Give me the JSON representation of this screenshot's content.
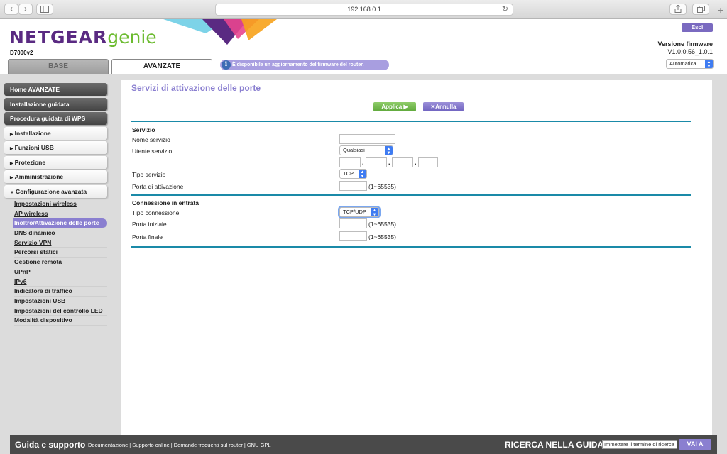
{
  "browser": {
    "url": "192.168.0.1"
  },
  "header": {
    "brand": "NETGEAR",
    "brand_suffix": "genie",
    "model": "D7000v2",
    "exit_label": "Esci",
    "firmware_title": "Versione firmware",
    "firmware_value": "V1.0.0.56_1.0.1",
    "tabs": [
      {
        "label": "BASE"
      },
      {
        "label": "AVANZATE"
      }
    ],
    "update_notice": "È disponibile un aggiornamento del firmware del router.",
    "language_selected": "Automatica",
    "banner_colors": [
      "#7dd3e8",
      "#5a2a82",
      "#e8458f",
      "#f7a21b"
    ]
  },
  "sidebar": {
    "main_items": [
      {
        "label": "Home AVANZATE"
      },
      {
        "label": "Installazione guidata"
      },
      {
        "label": "Procedura guidata di WPS"
      }
    ],
    "collapsible": [
      {
        "label": "Installazione"
      },
      {
        "label": "Funzioni USB"
      },
      {
        "label": "Protezione"
      },
      {
        "label": "Amministrazione"
      },
      {
        "label": "Configurazione avanzata"
      }
    ],
    "sub_items": [
      {
        "label": "Impostazioni wireless"
      },
      {
        "label": "AP wireless"
      },
      {
        "label": "Inoltro/Attivazione delle porte"
      },
      {
        "label": "DNS dinamico"
      },
      {
        "label": "Servizio VPN"
      },
      {
        "label": "Percorsi statici"
      },
      {
        "label": "Gestione remota"
      },
      {
        "label": "UPnP"
      },
      {
        "label": "IPv6"
      },
      {
        "label": "Indicatore di traffico"
      },
      {
        "label": "Impostazioni USB"
      },
      {
        "label": "Impostazioni del controllo LED"
      },
      {
        "label": "Modalità dispositivo"
      }
    ]
  },
  "main": {
    "title": "Servizi di attivazione delle porte",
    "apply_label": "Applica ▶",
    "cancel_label": "✕Annulla",
    "service": {
      "section_title": "Servizio",
      "name_label": "Nome servizio",
      "name_value": "",
      "user_label": "Utente servizio",
      "user_selected": "Qualsiasi",
      "type_label": "Tipo servizio",
      "type_selected": "TCP",
      "port_label": "Porta di attivazione",
      "port_value": "",
      "range_hint": "(1~65535)"
    },
    "inbound": {
      "section_title": "Connessione in entrata",
      "conn_type_label": "Tipo connessione:",
      "conn_type_selected": "TCP/UDP",
      "start_port_label": "Porta iniziale",
      "end_port_label": "Porta finale",
      "range_hint": "(1~65535)"
    }
  },
  "footer": {
    "title": "Guida e supporto",
    "links": [
      "Documentazione",
      "Supporto online",
      "Domande frequenti sul router",
      "GNU GPL"
    ],
    "search_title": "RICERCA NELLA GUIDA",
    "search_placeholder": "Immettere il termine di ricerca",
    "go_label": "VAI A"
  }
}
